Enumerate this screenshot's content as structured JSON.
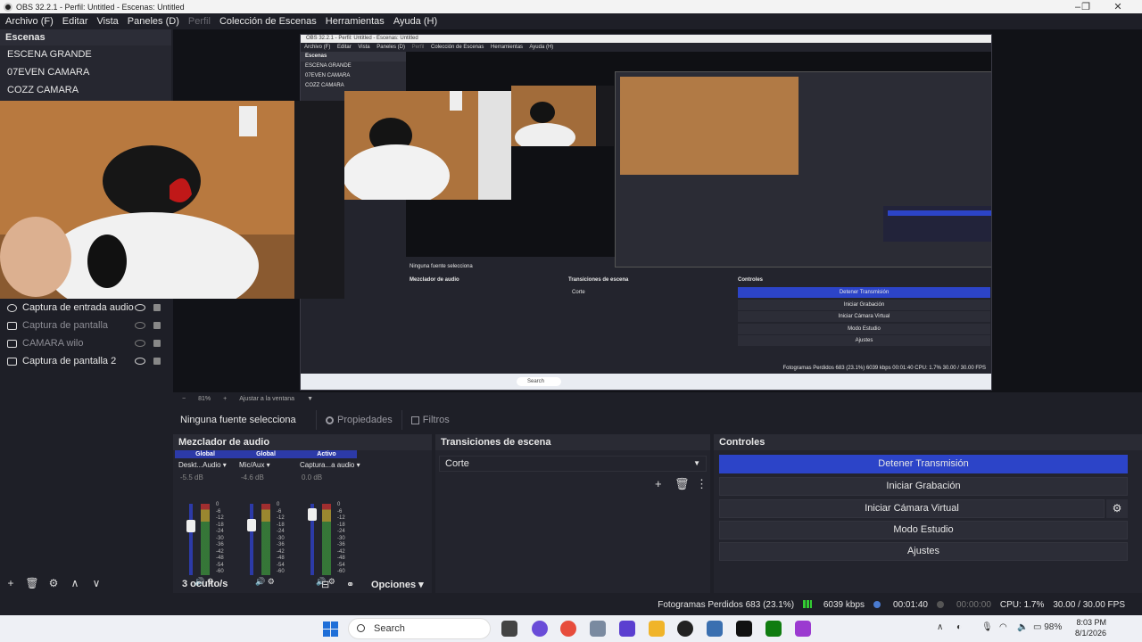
{
  "window": {
    "title": "OBS 32.2.1 - Perfil: Untitled - Escenas: Untitled",
    "controls": [
      "–",
      "❐",
      "✕"
    ]
  },
  "menu": [
    "Archivo (F)",
    "Editar",
    "Vista",
    "Paneles (D)",
    "Perfil",
    "Colección de Escenas",
    "Herramientas",
    "Ayuda (H)"
  ],
  "scenes": {
    "header": "Escenas",
    "items": [
      "ESCENA GRANDE",
      "07EVEN CAMARA",
      "COZZ CAMARA"
    ]
  },
  "sources": {
    "items": [
      {
        "label": "Captura de entrada audio",
        "icon": "audio-input-icon",
        "visible": true
      },
      {
        "label": "Captura de pantalla",
        "icon": "monitor-icon",
        "visible": false
      },
      {
        "label": "CAMARA wilo",
        "icon": "camera-icon",
        "visible": false
      },
      {
        "label": "Captura de pantalla 2",
        "icon": "monitor-icon",
        "visible": true
      }
    ],
    "toolbar": [
      "+",
      "🗑",
      "⚙",
      "∧",
      "∨"
    ]
  },
  "nested_preview": {
    "title": "OBS 32.2.1 - Perfil: Untitled - Escenas: Untitled",
    "menu": [
      "Archivo (F)",
      "Editar",
      "Vista",
      "Paneles (D)",
      "Perfil",
      "Colección de Escenas",
      "Herramientas",
      "Ayuda (H)"
    ],
    "scenes_header": "Escenas",
    "scenes": [
      "ESCENA GRANDE",
      "07EVEN CAMARA",
      "COZZ CAMARA"
    ],
    "no_source": "Ninguna fuente selecciona",
    "mixer_label": "Mezclador de audio",
    "transitions_label": "Transiciones de escena",
    "transition": "Corte",
    "controls_label": "Controles",
    "controls": [
      "Detener Transmisión",
      "Iniciar Grabación",
      "Iniciar Cámara Virtual",
      "Modo Estudio",
      "Ajustes"
    ],
    "status": "Fotogramas Perdidos 683 (23.1%)   6039 kbps   00:01:40   CPU: 1.7%   30.00 / 30.00 FPS",
    "taskbar_search": "Search"
  },
  "zoom": {
    "minus": "−",
    "level": "81%",
    "plus": "+",
    "fit": "Ajustar a la ventana",
    "arrow": "▼"
  },
  "context": {
    "no_source": "Ninguna fuente selecciona",
    "properties": "Propiedades",
    "filters": "Filtros"
  },
  "mixer": {
    "title": "Mezclador de audio",
    "channels": [
      {
        "tag": "Global",
        "name": "Deskt...Audio",
        "db": "-5.5 dB",
        "level": 0.72
      },
      {
        "tag": "Global",
        "name": "Mic/Aux",
        "db": "-4.6 dB",
        "level": 0.74
      },
      {
        "tag": "Activo",
        "name": "Captura...a audio",
        "db": "0.0 dB",
        "level": 0.92
      }
    ],
    "scale": [
      "0",
      "-6",
      "-12",
      "-18",
      "-24",
      "-30",
      "-36",
      "-42",
      "-48",
      "-54",
      "-60"
    ],
    "hidden": "3 oculto/s",
    "options": "Opciones"
  },
  "transitions": {
    "title": "Transiciones de escena",
    "selected": "Corte"
  },
  "controls": {
    "title": "Controles",
    "stop_stream": "Detener Transmisión",
    "start_recording": "Iniciar Grabación",
    "start_virtual_cam": "Iniciar Cámara Virtual",
    "studio_mode": "Modo Estudio",
    "settings": "Ajustes",
    "accent": "#2c44c8"
  },
  "status": {
    "dropped_frames": "Fotogramas Perdidos 683 (23.1%)",
    "bitrate": "6039 kbps",
    "stream_time": "00:01:40",
    "record_time": "00:00:00",
    "cpu": "CPU: 1.7%",
    "fps": "30.00 / 30.00 FPS"
  },
  "taskbar": {
    "search": "Search",
    "battery": "98%",
    "time": "8:03 PM",
    "date": "8/1/2026"
  }
}
